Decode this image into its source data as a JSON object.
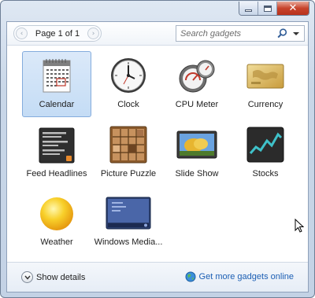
{
  "toolbar": {
    "page_label": "Page 1 of 1",
    "prev_glyph": "‹",
    "next_glyph": "›",
    "search_placeholder": "Search gadgets"
  },
  "gadgets": [
    {
      "label": "Calendar",
      "icon": "calendar-icon",
      "selected": true
    },
    {
      "label": "Clock",
      "icon": "clock-icon",
      "selected": false
    },
    {
      "label": "CPU Meter",
      "icon": "cpu-meter-icon",
      "selected": false
    },
    {
      "label": "Currency",
      "icon": "currency-icon",
      "selected": false
    },
    {
      "label": "Feed Headlines",
      "icon": "feed-headlines-icon",
      "selected": false
    },
    {
      "label": "Picture Puzzle",
      "icon": "picture-puzzle-icon",
      "selected": false
    },
    {
      "label": "Slide Show",
      "icon": "slide-show-icon",
      "selected": false
    },
    {
      "label": "Stocks",
      "icon": "stocks-icon",
      "selected": false
    },
    {
      "label": "Weather",
      "icon": "weather-icon",
      "selected": false
    },
    {
      "label": "Windows Media...",
      "icon": "windows-media-icon",
      "selected": false
    }
  ],
  "footer": {
    "show_details_label": "Show details",
    "get_more_label": "Get more gadgets online"
  },
  "colors": {
    "selection": "#c4dcf5",
    "link": "#1c5fb4",
    "close_button": "#c7432b"
  }
}
